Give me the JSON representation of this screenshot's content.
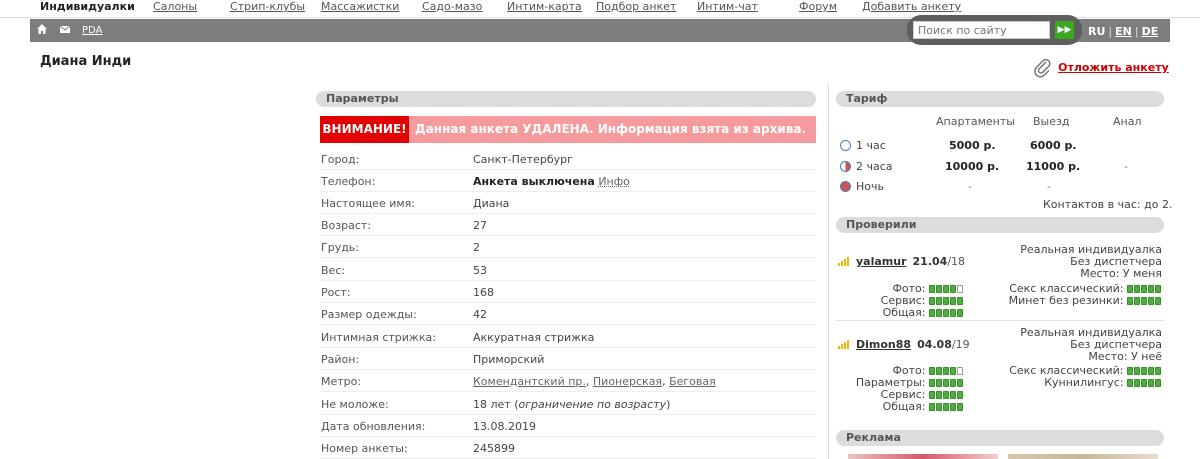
{
  "nav": {
    "items": [
      {
        "label": "Индивидуалки",
        "active": true
      },
      {
        "label": "Салоны"
      },
      {
        "label": "Стрип-клубы"
      },
      {
        "label": "Массажистки"
      },
      {
        "label": "Садо-мазо"
      },
      {
        "label": "Интим-карта"
      },
      {
        "label": "Подбор анкет"
      },
      {
        "label": "Интим-чат"
      },
      {
        "label": "Форум"
      },
      {
        "label": "Добавить анкету"
      }
    ]
  },
  "toolbar": {
    "home_icon": "home-icon",
    "mail_icon": "mail-icon",
    "pda_label": "PDA",
    "search_placeholder": "Поиск по сайту",
    "search_button_icon": "forward-icon",
    "languages": [
      "RU",
      "EN",
      "DE"
    ]
  },
  "profile": {
    "title": "Диана Инди",
    "defer_label": "Отложить анкету"
  },
  "params": {
    "header": "Параметры",
    "warning_badge": "ВНИМАНИЕ!",
    "warning_text": "Данная анкета УДАЛЕНА. Информация взята из архива.",
    "rows": [
      {
        "label": "Город:",
        "value": "Санкт-Петербург"
      },
      {
        "label": "Телефон:",
        "value": "Анкета выключена",
        "link": "Инфо"
      },
      {
        "label": "Настоящее имя:",
        "value": "Диана"
      },
      {
        "label": "Возраст:",
        "value": "27"
      },
      {
        "label": "Грудь:",
        "value": "2"
      },
      {
        "label": "Вес:",
        "value": "53"
      },
      {
        "label": "Рост:",
        "value": "168"
      },
      {
        "label": "Размер одежды:",
        "value": "42"
      },
      {
        "label": "Интимная стрижка:",
        "value": "Аккуратная стрижка"
      },
      {
        "label": "Район:",
        "value": "Приморский"
      },
      {
        "label": "Метро:",
        "metro": [
          "Комендантский пр.",
          "Пионерская",
          "Беговая"
        ]
      },
      {
        "label": "Не моложе:",
        "value": "18 лет",
        "note": "ограничение по возрасту"
      },
      {
        "label": "Дата обновления:",
        "value": "13.08.2019"
      },
      {
        "label": "Номер анкеты:",
        "value": "245899"
      }
    ]
  },
  "tariff": {
    "header": "Тариф",
    "columns": [
      "Апартаменты",
      "Выезд",
      "Анал"
    ],
    "rows": [
      {
        "label": "1 час",
        "apartments": "5000 р.",
        "outcall": "6000 р.",
        "anal": ""
      },
      {
        "label": "2 часа",
        "apartments": "10000 р.",
        "outcall": "11000 р.",
        "anal": "-"
      },
      {
        "label": "Ночь",
        "apartments": "-",
        "outcall": "-",
        "anal": ""
      }
    ],
    "contacts": "Контактов в час: до 2."
  },
  "checked": {
    "header": "Проверили",
    "reviews": [
      {
        "user": "yalamur",
        "date": "21.04",
        "year": "/18",
        "info": [
          "Реальная индивидуалка",
          "Без диспетчера",
          "Место: У меня"
        ],
        "left": [
          {
            "label": "Фото:",
            "score": 4
          },
          {
            "label": "Сервис:",
            "score": 5
          },
          {
            "label": "Общая:",
            "score": 5
          }
        ],
        "right": [
          {
            "label": "Секс классический:",
            "score": 5
          },
          {
            "label": "Минет без резинки:",
            "score": 5
          }
        ]
      },
      {
        "user": "Dimon88",
        "date": "04.08",
        "year": "/19",
        "info": [
          "Реальная индивидуалка",
          "Без диспетчера",
          "Место: У неё"
        ],
        "left": [
          {
            "label": "Фото:",
            "score": 4
          },
          {
            "label": "Параметры:",
            "score": 5
          },
          {
            "label": "Сервис:",
            "score": 5
          },
          {
            "label": "Общая:",
            "score": 5
          }
        ],
        "right": [
          {
            "label": "Секс классический:",
            "score": 5
          },
          {
            "label": "Куннилингус:",
            "score": 5
          }
        ]
      }
    ]
  },
  "ads": {
    "header": "Реклама"
  }
}
